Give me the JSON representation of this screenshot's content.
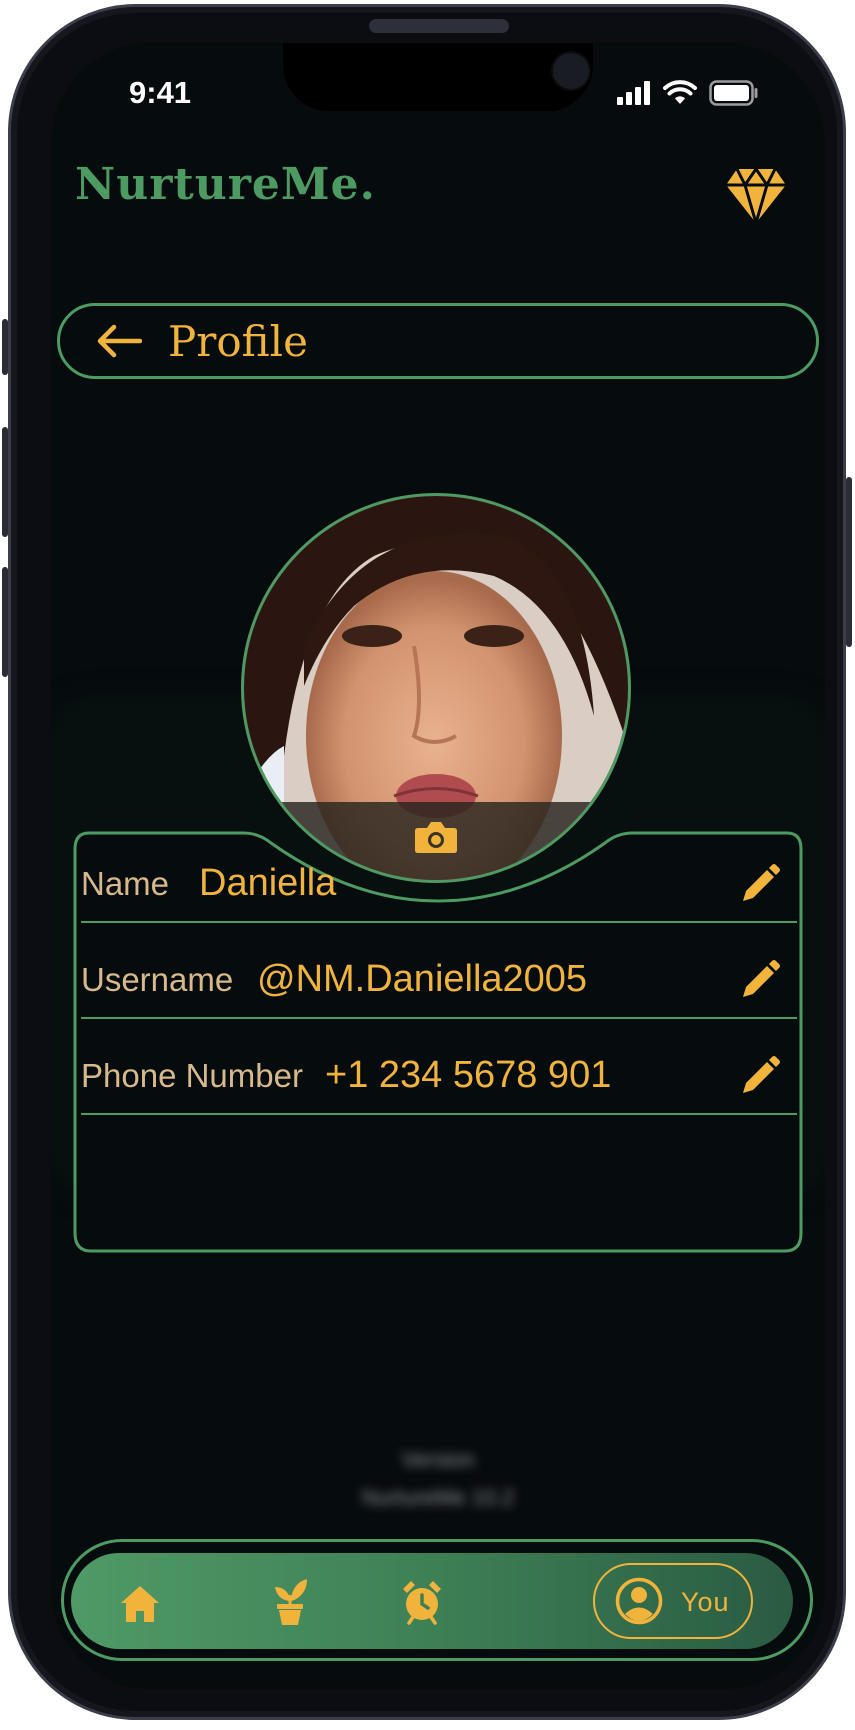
{
  "status_bar": {
    "time": "9:41"
  },
  "app": {
    "logo_text": "NurtureMe",
    "logo_dot": "."
  },
  "header": {
    "title": "Profile"
  },
  "profile_fields": [
    {
      "label": "Name",
      "value": "Daniella"
    },
    {
      "label": "Username",
      "value": "@NM.Daniella2005"
    },
    {
      "label": "Phone Number",
      "value": "+1 234 5678 901"
    }
  ],
  "footer": {
    "line1": "Version",
    "line2": "NurtureMe 10.2"
  },
  "bottom_nav": {
    "you_label": "You"
  },
  "colors": {
    "accent": "#f0b43c",
    "brand_green": "#4d9b62",
    "background": "#060b0e"
  },
  "icons": [
    "back-arrow-icon",
    "diamond-icon",
    "camera-icon",
    "pencil-icon",
    "home-icon",
    "plant-icon",
    "alarm-clock-icon",
    "user-icon"
  ]
}
